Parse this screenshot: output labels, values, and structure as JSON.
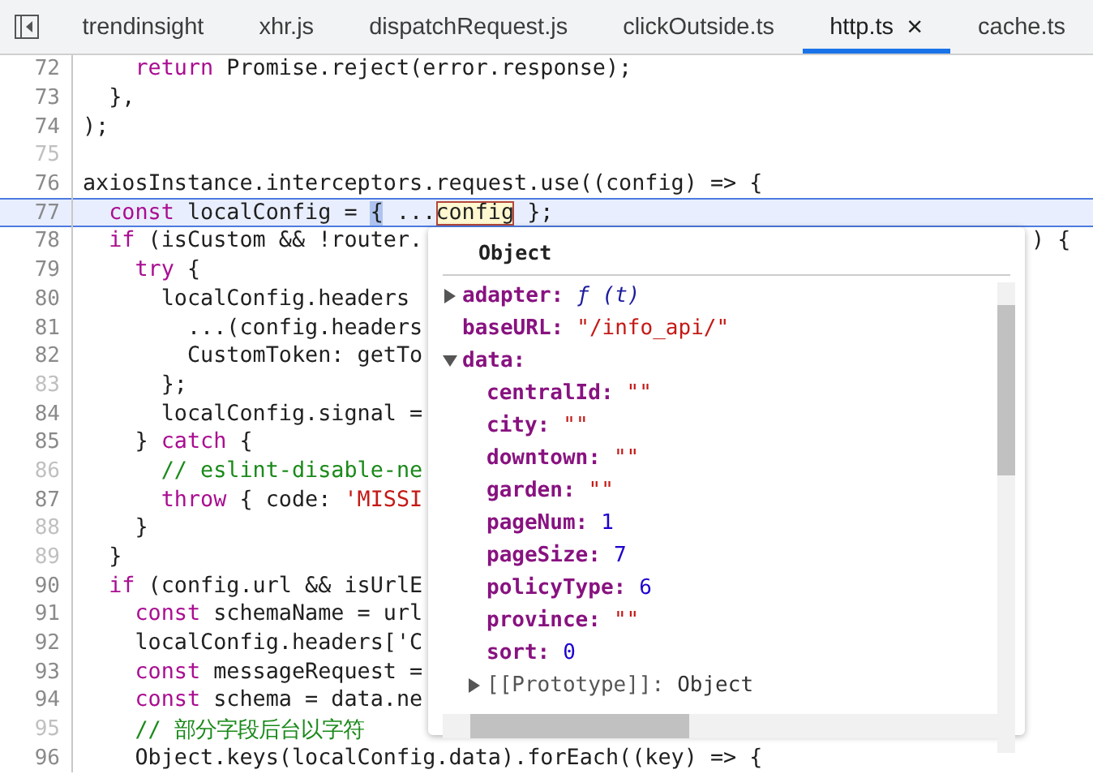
{
  "tabs": [
    {
      "label": "trendinsight",
      "selected": false,
      "closable": false
    },
    {
      "label": "xhr.js",
      "selected": false,
      "closable": false
    },
    {
      "label": "dispatchRequest.js",
      "selected": false,
      "closable": false
    },
    {
      "label": "clickOutside.ts",
      "selected": false,
      "closable": false
    },
    {
      "label": "http.ts",
      "selected": true,
      "closable": true,
      "close_label": "×"
    },
    {
      "label": "cache.ts",
      "selected": false,
      "closable": false
    }
  ],
  "code_lines": [
    {
      "number": "72",
      "muted": false,
      "current": false,
      "tokens": [
        {
          "kind": "keyword",
          "text": "    return"
        },
        {
          "kind": "plain",
          "text": " Promise.reject(error.response);"
        }
      ]
    },
    {
      "number": "73",
      "muted": false,
      "current": false,
      "tokens": [
        {
          "kind": "plain",
          "text": "  },"
        }
      ]
    },
    {
      "number": "74",
      "muted": false,
      "current": false,
      "tokens": [
        {
          "kind": "plain",
          "text": ");"
        }
      ]
    },
    {
      "number": "75",
      "muted": true,
      "current": false
    },
    {
      "number": "76",
      "muted": false,
      "current": false,
      "tokens": [
        {
          "kind": "plain",
          "text": "axiosInstance.interceptors.request.use((config) => {"
        }
      ]
    },
    {
      "number": "77",
      "muted": false,
      "current": true,
      "tokens": [
        {
          "kind": "keyword",
          "text": "  const"
        },
        {
          "kind": "plain",
          "text": " localConfig = "
        },
        {
          "kind": "bracket",
          "text": "{"
        },
        {
          "kind": "plain",
          "text": " ..."
        },
        {
          "kind": "hovered",
          "text": "config"
        },
        {
          "kind": "plain",
          "text": " };"
        }
      ]
    },
    {
      "number": "78",
      "muted": false,
      "current": false,
      "tokens": [
        {
          "kind": "keyword",
          "text": "  if"
        },
        {
          "kind": "plain",
          "text": " (isCustom && !router."
        }
      ],
      "tail": ") {"
    },
    {
      "number": "79",
      "muted": false,
      "current": false,
      "tokens": [
        {
          "kind": "keyword",
          "text": "    try"
        },
        {
          "kind": "plain",
          "text": " {"
        }
      ]
    },
    {
      "number": "80",
      "muted": false,
      "current": false,
      "tokens": [
        {
          "kind": "plain",
          "text": "      localConfig.headers"
        }
      ]
    },
    {
      "number": "81",
      "muted": false,
      "current": false,
      "tokens": [
        {
          "kind": "plain",
          "text": "        ...(config.headers"
        }
      ]
    },
    {
      "number": "82",
      "muted": false,
      "current": false,
      "tokens": [
        {
          "kind": "plain",
          "text": "        CustomToken: getTo"
        }
      ]
    },
    {
      "number": "83",
      "muted": true,
      "current": false,
      "tokens": [
        {
          "kind": "plain",
          "text": "      };"
        }
      ]
    },
    {
      "number": "84",
      "muted": false,
      "current": false,
      "tokens": [
        {
          "kind": "plain",
          "text": "      localConfig.signal ="
        }
      ]
    },
    {
      "number": "85",
      "muted": false,
      "current": false,
      "tokens": [
        {
          "kind": "plain",
          "text": "    } "
        },
        {
          "kind": "keyword",
          "text": "catch"
        },
        {
          "kind": "plain",
          "text": " {"
        }
      ]
    },
    {
      "number": "86",
      "muted": true,
      "current": false,
      "tokens": [
        {
          "kind": "comment",
          "text": "      // eslint-disable-ne"
        }
      ]
    },
    {
      "number": "87",
      "muted": false,
      "current": false,
      "tokens": [
        {
          "kind": "keyword",
          "text": "      throw"
        },
        {
          "kind": "plain",
          "text": " { code: "
        },
        {
          "kind": "string",
          "text": "'MISSI"
        }
      ]
    },
    {
      "number": "88",
      "muted": true,
      "current": false,
      "tokens": [
        {
          "kind": "plain",
          "text": "    }"
        }
      ]
    },
    {
      "number": "89",
      "muted": true,
      "current": false,
      "tokens": [
        {
          "kind": "plain",
          "text": "  }"
        }
      ]
    },
    {
      "number": "90",
      "muted": false,
      "current": false,
      "tokens": [
        {
          "kind": "keyword",
          "text": "  if"
        },
        {
          "kind": "plain",
          "text": " (config.url && isUrlE"
        }
      ]
    },
    {
      "number": "91",
      "muted": false,
      "current": false,
      "tokens": [
        {
          "kind": "keyword",
          "text": "    const"
        },
        {
          "kind": "plain",
          "text": " schemaName = url"
        }
      ]
    },
    {
      "number": "92",
      "muted": false,
      "current": false,
      "tokens": [
        {
          "kind": "plain",
          "text": "    localConfig.headers['C"
        }
      ]
    },
    {
      "number": "93",
      "muted": false,
      "current": false,
      "tokens": [
        {
          "kind": "keyword",
          "text": "    const"
        },
        {
          "kind": "plain",
          "text": " messageRequest ="
        }
      ]
    },
    {
      "number": "94",
      "muted": false,
      "current": false,
      "tokens": [
        {
          "kind": "keyword",
          "text": "    const"
        },
        {
          "kind": "plain",
          "text": " schema = data.ne"
        }
      ]
    },
    {
      "number": "95",
      "muted": true,
      "current": false,
      "tokens": [
        {
          "kind": "comment",
          "text": "    // 部分字段后台以字符"
        }
      ]
    },
    {
      "number": "96",
      "muted": false,
      "current": false,
      "tokens": [
        {
          "kind": "plain",
          "text": "    Object.keys(localConfig.data).forEach((key) => {"
        }
      ]
    }
  ],
  "popup": {
    "title": "Object",
    "properties": [
      {
        "key": "adapter:",
        "value": "ƒ (t)",
        "kind": "function",
        "expanded": false
      },
      {
        "key": "baseURL:",
        "value": "\"/info_api/\"",
        "kind": "string"
      },
      {
        "key": "data:",
        "kind": "object",
        "expanded": true,
        "children": [
          {
            "key": "centralId:",
            "value": "\"\"",
            "kind": "string"
          },
          {
            "key": "city:",
            "value": "\"\"",
            "kind": "string"
          },
          {
            "key": "downtown:",
            "value": "\"\"",
            "kind": "string"
          },
          {
            "key": "garden:",
            "value": "\"\"",
            "kind": "string"
          },
          {
            "key": "pageNum:",
            "value": "1",
            "kind": "number"
          },
          {
            "key": "pageSize:",
            "value": "7",
            "kind": "number"
          },
          {
            "key": "policyType:",
            "value": "6",
            "kind": "number"
          },
          {
            "key": "province:",
            "value": "\"\"",
            "kind": "string"
          },
          {
            "key": "sort:",
            "value": "0",
            "kind": "number"
          },
          {
            "key": "[[Prototype]]:",
            "value": "Object",
            "kind": "internal",
            "expanded": false
          }
        ]
      }
    ]
  }
}
